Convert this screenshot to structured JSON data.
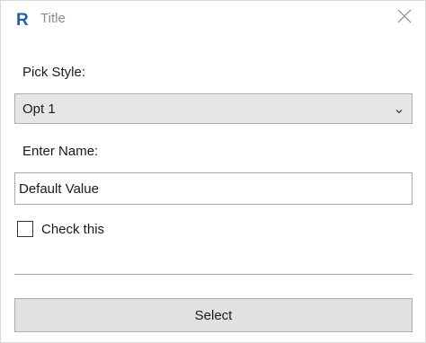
{
  "window": {
    "title": "Title",
    "app_icon": "revit-r-icon",
    "close_icon": "close-icon"
  },
  "form": {
    "pick_style_label": "Pick Style:",
    "pick_style_selected": "Opt 1",
    "enter_name_label": "Enter Name:",
    "name_value": "Default Value",
    "checkbox_label": "Check this",
    "checkbox_checked": false,
    "submit_label": "Select"
  },
  "colors": {
    "icon_blue": "#1e5fa8",
    "title_gray": "#8a8a8a",
    "control_bg": "#e6e6e6",
    "button_bg": "#e1e1e1"
  }
}
